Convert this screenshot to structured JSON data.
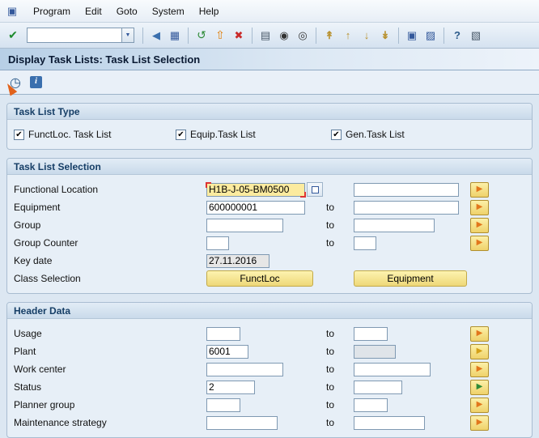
{
  "colors": {
    "field_focus": "#fceb9f",
    "arrow_orange": "#e2771c",
    "section_title": "#163e66"
  },
  "glyphs": {
    "window_icon": "▣",
    "enter": "✔",
    "dropdown": "▼",
    "multi_arrow": "▶",
    "execute": "◷",
    "info": "i"
  },
  "menu": {
    "items": [
      {
        "label": "Program"
      },
      {
        "label": "Edit"
      },
      {
        "label": "Goto"
      },
      {
        "label": "System"
      },
      {
        "label": "Help"
      }
    ]
  },
  "toolbar": {
    "command_value": "",
    "icons": [
      {
        "name": "back",
        "glyph": "◀"
      },
      {
        "name": "save",
        "glyph": "▦"
      },
      {
        "name": "refresh",
        "glyph": "↺"
      },
      {
        "name": "exit",
        "glyph": "⇧"
      },
      {
        "name": "cancel",
        "glyph": "✖"
      },
      {
        "name": "print",
        "glyph": "▤"
      },
      {
        "name": "find",
        "glyph": "◉"
      },
      {
        "name": "find-next",
        "glyph": "◎"
      },
      {
        "name": "first-page",
        "glyph": "↟"
      },
      {
        "name": "page-up",
        "glyph": "↑"
      },
      {
        "name": "page-down",
        "glyph": "↓"
      },
      {
        "name": "last-page",
        "glyph": "↡"
      },
      {
        "name": "new-session",
        "glyph": "▣"
      },
      {
        "name": "shortcut",
        "glyph": "▨"
      },
      {
        "name": "help",
        "glyph": "?"
      },
      {
        "name": "customize",
        "glyph": "▧"
      }
    ]
  },
  "title": "Display Task Lists: Task List Selection",
  "sections": {
    "task_list_type": {
      "title": "Task List Type",
      "checkboxes": [
        {
          "label": "FunctLoc. Task List",
          "checked": true,
          "glyph": "✔"
        },
        {
          "label": "Equip.Task List",
          "checked": true,
          "glyph": "✔"
        },
        {
          "label": "Gen.Task List",
          "checked": true,
          "glyph": "✔"
        }
      ]
    },
    "task_list_selection": {
      "title": "Task List Selection",
      "rows": [
        {
          "label": "Functional Location",
          "value": "H1B-J-05-BM0500",
          "to_label": "",
          "to_value": ""
        },
        {
          "label": "Equipment",
          "value": "600000001",
          "to_label": "to",
          "to_value": ""
        },
        {
          "label": "Group",
          "value": "",
          "to_label": "to",
          "to_value": ""
        },
        {
          "label": "Group Counter",
          "value": "",
          "to_label": "to",
          "to_value": ""
        },
        {
          "label": "Key date",
          "value": "27.11.2016"
        },
        {
          "label": "Class Selection"
        }
      ],
      "class_buttons": [
        {
          "label": "FunctLoc"
        },
        {
          "label": "Equipment"
        }
      ]
    },
    "header_data": {
      "title": "Header Data",
      "rows": [
        {
          "label": "Usage",
          "value": "",
          "to_label": "to",
          "to_value": ""
        },
        {
          "label": "Plant",
          "value": "6001",
          "to_label": "to",
          "to_value": ""
        },
        {
          "label": "Work center",
          "value": "",
          "to_label": "to",
          "to_value": ""
        },
        {
          "label": "Status",
          "value": "2",
          "to_label": "to",
          "to_value": ""
        },
        {
          "label": "Planner group",
          "value": "",
          "to_label": "to",
          "to_value": ""
        },
        {
          "label": "Maintenance strategy",
          "value": "",
          "to_label": "to",
          "to_value": ""
        }
      ]
    }
  }
}
